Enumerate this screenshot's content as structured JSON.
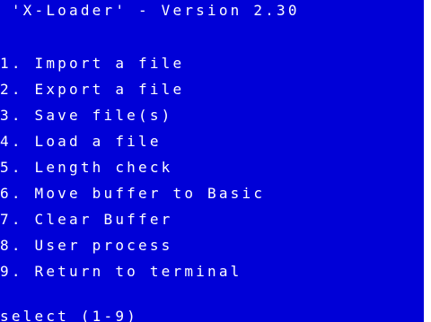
{
  "title": " 'X-Loader' - Version 2.30",
  "menu": [
    {
      "label": "1. Import a file"
    },
    {
      "label": "2. Export a file"
    },
    {
      "label": "3. Save file(s)"
    },
    {
      "label": "4. Load a file"
    },
    {
      "label": "5. Length check"
    },
    {
      "label": "6. Move buffer to Basic"
    },
    {
      "label": "7. Clear Buffer"
    },
    {
      "label": "8. User process"
    },
    {
      "label": "9. Return to terminal"
    }
  ],
  "prompt": "select (1-9)",
  "colors": {
    "background": "#0000d7",
    "text": "#ffffff"
  }
}
